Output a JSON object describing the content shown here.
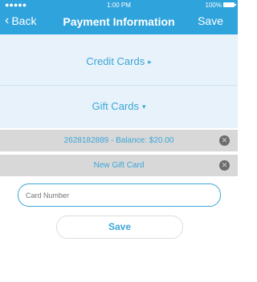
{
  "status_bar": {
    "signal": "●●●●●",
    "time": "1:00 PM",
    "battery": "100%"
  },
  "nav": {
    "back_label": "Back",
    "back_icon": "chevron-left-icon",
    "title": "Payment Information",
    "save_label": "Save"
  },
  "sections": {
    "credit_cards": {
      "label": "Credit Cards",
      "indicator": "▸"
    },
    "gift_cards": {
      "label": "Gift Cards",
      "indicator": "▾"
    }
  },
  "gift_rows": [
    {
      "label": "2628182889 - Balance: $20.00",
      "remove_icon": "close-circle-icon"
    },
    {
      "label": "New Gift Card",
      "remove_icon": "close-circle-icon"
    }
  ],
  "card_input": {
    "placeholder": "Card Number",
    "value": ""
  },
  "save_button": {
    "label": "Save"
  },
  "colors": {
    "accent": "#2fa3dc",
    "section_bg": "#e8f2fa",
    "row_bg": "#d8d8d8"
  }
}
